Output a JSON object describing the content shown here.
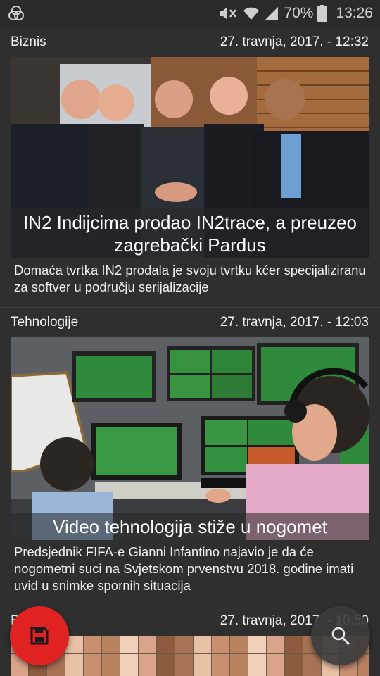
{
  "status_bar": {
    "battery": "70%",
    "time": "13:26",
    "icons": [
      "app-icon",
      "mute-icon",
      "wifi-icon",
      "signal-icon",
      "battery-icon"
    ]
  },
  "articles": [
    {
      "category": "Biznis",
      "date": "27. travnja, 2017. - 12:32",
      "headline": "IN2 Indijcima prodao IN2trace, a preuzeo zagrebački Pardus",
      "summary": " Domaća tvrtka IN2 prodala je svoju tvrtku kćer specijaliziranu za softver u području serijalizacije"
    },
    {
      "category": "Tehnologije",
      "date": "27. travnja, 2017. - 12:03",
      "headline": "Video tehnologija stiže u nogomet",
      "summary": " Predsjednik FIFA-e Gianni Infantino najavio je da će nogometni suci na Svjetskom prvenstvu 2018. godine imati uvid u snimke spornih situacija"
    },
    {
      "category": "Biz",
      "date": "27. travnja, 2017. - 10:50"
    }
  ],
  "fabs": {
    "save": "save-icon",
    "search": "search-icon"
  },
  "colors": {
    "background": "#2f2f2f",
    "fab_save": "#e02222",
    "fab_search": "#3c3c3c"
  }
}
